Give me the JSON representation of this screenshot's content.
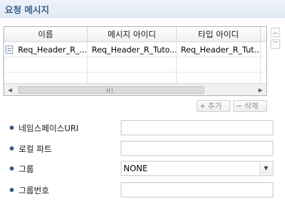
{
  "section": {
    "title": "요청 메시지"
  },
  "table": {
    "columns": [
      "이름",
      "메시지 아이디",
      "타입 아이디"
    ],
    "rows": [
      {
        "name": "Req_Header_R_...",
        "message_id": "Req_Header_R_Tuto...",
        "type_id": "Req_Header_R_Tut..."
      }
    ]
  },
  "buttons": {
    "add": "추가",
    "delete": "삭제"
  },
  "icons": {
    "row": "message-document-icon",
    "move_up": "chevron-up-icon",
    "move_down": "chevron-down-icon",
    "add": "plus-icon",
    "delete": "minus-icon"
  },
  "form": {
    "namespace_uri": {
      "label": "네임스페이스URI",
      "value": ""
    },
    "local_part": {
      "label": "로컬 파트",
      "value": ""
    },
    "group": {
      "label": "그룹",
      "value": "NONE"
    },
    "group_number": {
      "label": "그룹번호",
      "value": ""
    }
  },
  "colors": {
    "title": "#3b5d8c",
    "bullet": "#3a5a82",
    "header_bg": "#e2eaf5"
  }
}
